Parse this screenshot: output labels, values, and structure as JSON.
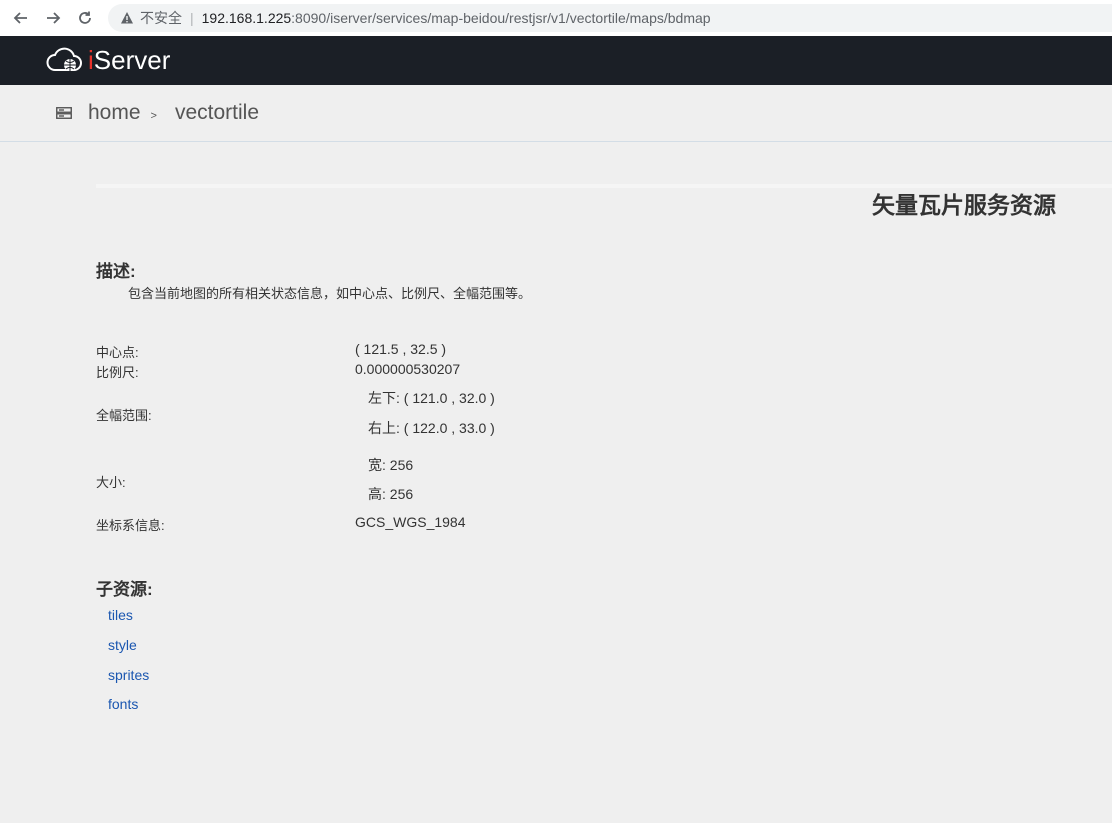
{
  "browser": {
    "insecure_label": "不安全",
    "url_host": "192.168.1.225",
    "url_rest": ":8090/iserver/services/map-beidou/restjsr/v1/vectortile/maps/bdmap"
  },
  "header": {
    "logo_i": "i",
    "logo_rest": "Server"
  },
  "breadcrumb": {
    "home": "home",
    "separator": ">",
    "current": "vectortile"
  },
  "page": {
    "title": "矢量瓦片服务资源",
    "description_heading": "描述:",
    "description": "包含当前地图的所有相关状态信息，如中心点、比例尺、全幅范围等。"
  },
  "properties": {
    "center_label": "中心点:",
    "center_value": "( 121.5 , 32.5 )",
    "scale_label": "比例尺:",
    "scale_value": "0.000000530207",
    "bounds_label": "全幅范围:",
    "bounds_lower_left": "左下: ( 121.0 , 32.0 )",
    "bounds_upper_right": "右上: ( 122.0 , 33.0 )",
    "size_label": "大小:",
    "size_width": "宽: 256",
    "size_height": "高: 256",
    "crs_label": "坐标系信息:",
    "crs_value": "GCS_WGS_1984"
  },
  "children": {
    "heading": "子资源:",
    "links": [
      "tiles",
      "style",
      "sprites",
      "fonts"
    ]
  }
}
